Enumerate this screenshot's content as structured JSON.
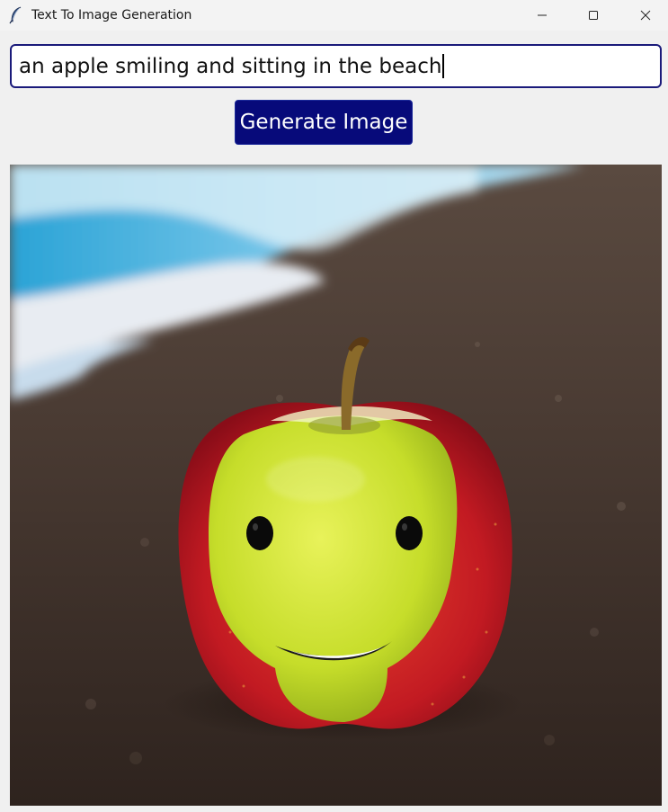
{
  "window": {
    "title": "Text To Image Generation",
    "app_icon": "feather-icon",
    "controls": [
      "minimize-icon",
      "maximize-icon",
      "close-icon"
    ]
  },
  "prompt_input": {
    "value": "an apple smiling and sitting in the beach"
  },
  "generate_button": {
    "label": "Generate Image",
    "color": "#070a7a"
  },
  "generated_image": {
    "content": "generated-apple-on-beach-image"
  }
}
